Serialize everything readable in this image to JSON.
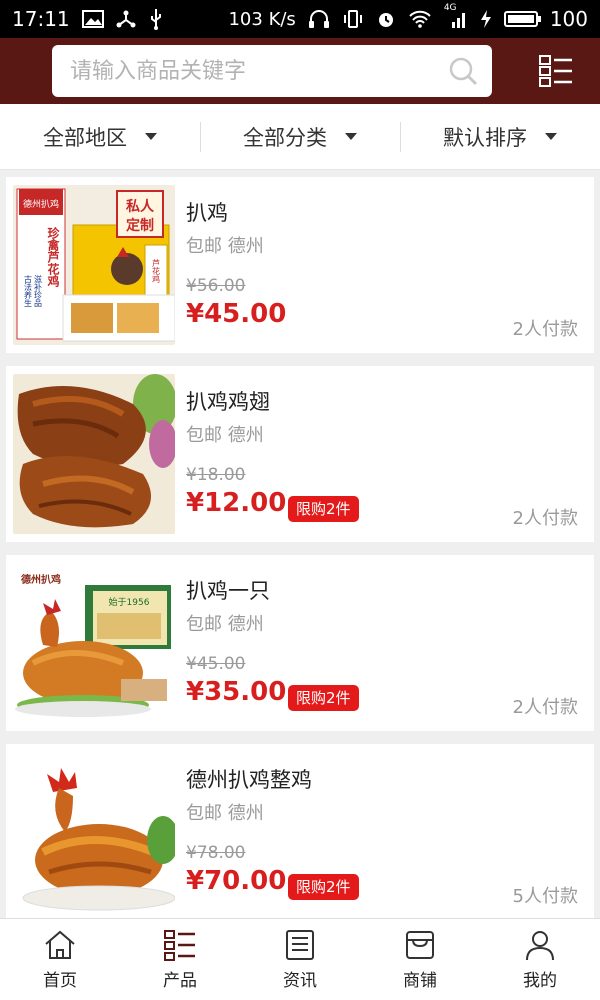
{
  "status_bar": {
    "time": "17:11",
    "net_speed": "103 K/s",
    "network": "4G",
    "battery": "100"
  },
  "search": {
    "placeholder": "请输入商品关键字"
  },
  "filters": [
    {
      "label": "全部地区"
    },
    {
      "label": "全部分类"
    },
    {
      "label": "默认排序"
    }
  ],
  "products": [
    {
      "title": "扒鸡",
      "meta": "包邮 德州",
      "old_price": "¥56.00",
      "price": "¥45.00",
      "limit": "",
      "sold": "2人付款",
      "image_text": [
        "德州扒鸡",
        "古法养生",
        "滋补珍品",
        "珍禽芦花鸡",
        "私人",
        "定制",
        "芦花鸡"
      ]
    },
    {
      "title": "扒鸡鸡翅",
      "meta": "包邮 德州",
      "old_price": "¥18.00",
      "price": "¥12.00",
      "limit": "限购2件",
      "sold": "2人付款"
    },
    {
      "title": "扒鸡一只",
      "meta": "包邮 德州",
      "old_price": "¥45.00",
      "price": "¥35.00",
      "limit": "限购2件",
      "sold": "2人付款",
      "image_text": [
        "德州扒鸡",
        "始于1956"
      ]
    },
    {
      "title": "德州扒鸡整鸡",
      "meta": "包邮 德州",
      "old_price": "¥78.00",
      "price": "¥70.00",
      "limit": "限购2件",
      "sold": "5人付款"
    }
  ],
  "bottom_nav": [
    {
      "label": "首页",
      "icon": "home-icon"
    },
    {
      "label": "产品",
      "icon": "products-icon",
      "active": true
    },
    {
      "label": "资讯",
      "icon": "news-icon"
    },
    {
      "label": "商铺",
      "icon": "shop-icon"
    },
    {
      "label": "我的",
      "icon": "user-icon"
    }
  ],
  "colors": {
    "header_bg": "#5a1814",
    "price_red": "#d71f1f",
    "active_nav": "#5a1814"
  }
}
